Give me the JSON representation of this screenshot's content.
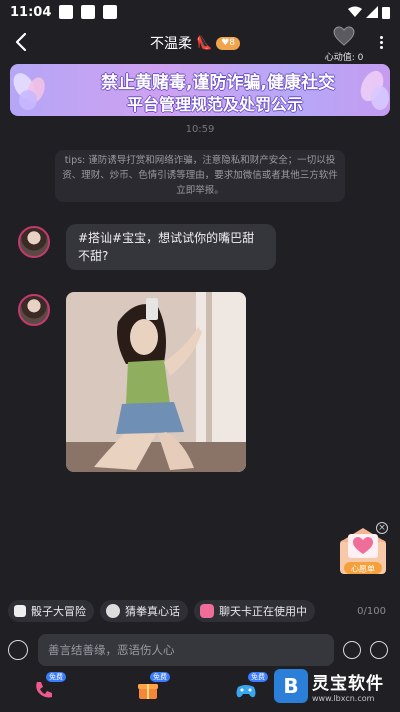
{
  "status_bar": {
    "time": "11:04"
  },
  "header": {
    "title": "不温柔",
    "title_emoji": "👠",
    "level_badge": "8",
    "heart_label": "心动值: 0"
  },
  "banner": {
    "line1": "禁止黄赌毒,谨防诈骗,健康社交",
    "line2": "平台管理规范及处罚公示"
  },
  "chat": {
    "timestamp": "10:59",
    "tips": "tips: 谨防诱导打赏和网络诈骗，注意隐私和财产安全；一切以投资、理财、炒币、色情引诱等理由，要求加微信或者其他三方软件立即举报。",
    "message_text": "#搭讪#宝宝，想试试你的嘴巴甜不甜?"
  },
  "gift": {
    "label": "心愿单",
    "close": "×"
  },
  "chips": [
    {
      "label": "骰子大冒险",
      "icon": "dice-icon"
    },
    {
      "label": "猜拳真心话",
      "icon": "hand-icon"
    },
    {
      "label": "聊天卡正在使用中",
      "icon": "chat-card-icon"
    }
  ],
  "char_counter": "0/100",
  "input": {
    "placeholder": "善言结善缘，恶语伤人心"
  },
  "bottom_badges": {
    "call": "免费",
    "gift": "免费",
    "game": "免费"
  },
  "watermark": {
    "logo": "B",
    "title": "灵宝软件",
    "url": "www.lbxcn.com"
  },
  "colors": {
    "background": "#1f1f24",
    "accent": "#c23a6e",
    "banner": "#b5a6f6"
  }
}
